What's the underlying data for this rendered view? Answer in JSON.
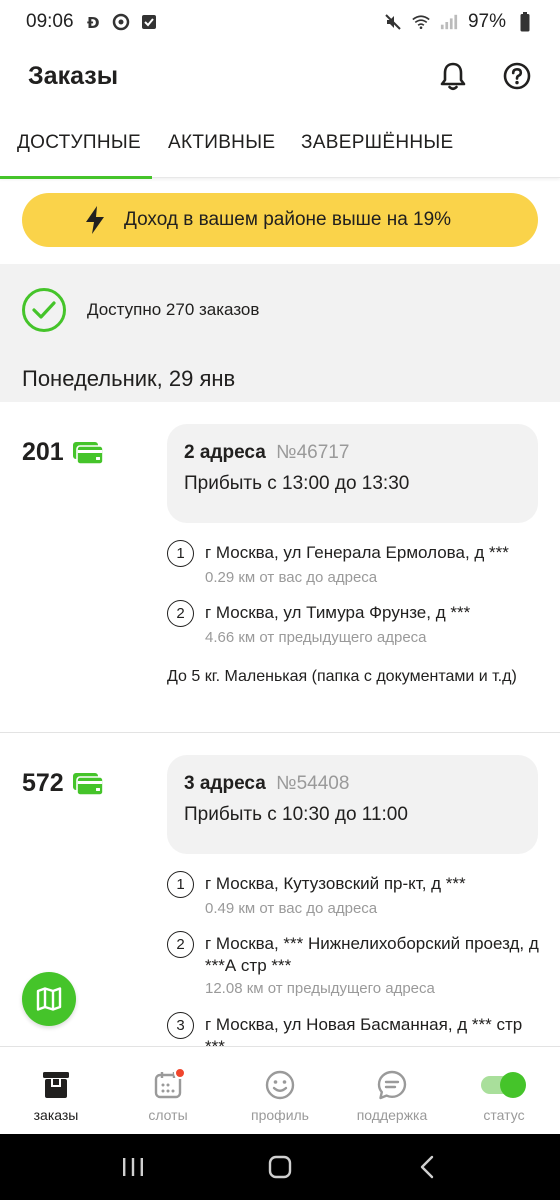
{
  "status_bar": {
    "time": "09:06",
    "battery": "97%"
  },
  "header": {
    "title": "Заказы"
  },
  "tabs": [
    {
      "label": "ДОСТУПНЫЕ",
      "active": true
    },
    {
      "label": "АКТИВНЫЕ",
      "active": false
    },
    {
      "label": "ЗАВЕРШЁННЫЕ",
      "active": false
    }
  ],
  "promo": {
    "text": "Доход в вашем районе выше на 19%"
  },
  "available": {
    "text": "Доступно 270 заказов"
  },
  "day_header": "Понедельник, 29 янв",
  "orders": [
    {
      "price": "201",
      "title": "2 адреса",
      "number": "№46717",
      "time": "Прибыть с 13:00 до 13:30",
      "stops": [
        {
          "num": "1",
          "address": "г Москва, ул Генерала Ермолова, д ***",
          "distance": "0.29 км от вас до адреса"
        },
        {
          "num": "2",
          "address": "г Москва, ул Тимура Фрунзе, д ***",
          "distance": "4.66 км от предыдущего адреса"
        }
      ],
      "note": "До 5 кг. Маленькая (папка с документами и т.д)"
    },
    {
      "price": "572",
      "title": "3 адреса",
      "number": "№54408",
      "time": "Прибыть с 10:30 до 11:00",
      "stops": [
        {
          "num": "1",
          "address": "г Москва, Кутузовский пр-кт, д ***",
          "distance": "0.49 км от вас до адреса"
        },
        {
          "num": "2",
          "address": "г Москва, *** Нижнелихоборский проезд, д ***А стр ***",
          "distance": "12.08 км от предыдущего адреса"
        },
        {
          "num": "3",
          "address": "г Москва, ул Новая Басманная, д *** стр ***",
          "distance": ""
        }
      ]
    }
  ],
  "bottom_nav": [
    {
      "label": "заказы",
      "icon": "orders-box-icon",
      "active": true
    },
    {
      "label": "слоты",
      "icon": "calendar-icon",
      "active": false
    },
    {
      "label": "профиль",
      "icon": "smile-icon",
      "active": false
    },
    {
      "label": "поддержка",
      "icon": "chat-icon",
      "active": false
    },
    {
      "label": "статус",
      "icon": "toggle-icon",
      "active": false
    }
  ],
  "colors": {
    "accent": "#45c42a",
    "promo": "#fad34a",
    "badge": "#f0462d"
  }
}
